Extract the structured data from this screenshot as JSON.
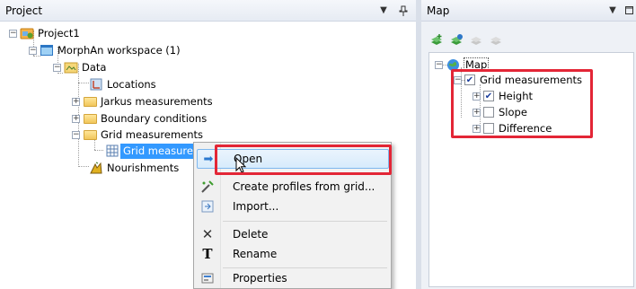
{
  "project_panel": {
    "title": "Project",
    "tree": {
      "project1": "Project1",
      "workspace": "MorphAn workspace (1)",
      "data": "Data",
      "locations": "Locations",
      "jarkus": "Jarkus measurements",
      "boundary": "Boundary conditions",
      "grid_measurements": "Grid measurements",
      "grid_child": "Grid measurem",
      "nourishments": "Nourishments"
    }
  },
  "context_menu": {
    "items": [
      {
        "label": "Open",
        "icon": "open-arrow-icon"
      },
      {
        "label": "Create profiles from grid...",
        "icon": "create-profiles-icon"
      },
      {
        "label": "Import...",
        "icon": "import-icon"
      },
      {
        "label": "Delete",
        "icon": "delete-icon"
      },
      {
        "label": "Rename",
        "icon": "rename-icon"
      },
      {
        "label": "Properties",
        "icon": "properties-icon"
      }
    ]
  },
  "map_panel": {
    "title": "Map",
    "tree": {
      "map": "Map",
      "grid_measurements": "Grid measurements",
      "height": "Height",
      "slope": "Slope",
      "difference": "Difference"
    },
    "checked": {
      "grid_measurements": true,
      "height": true,
      "slope": false,
      "difference": false
    }
  },
  "colors": {
    "highlight_red": "#e32636",
    "selection_blue": "#3399ff"
  }
}
